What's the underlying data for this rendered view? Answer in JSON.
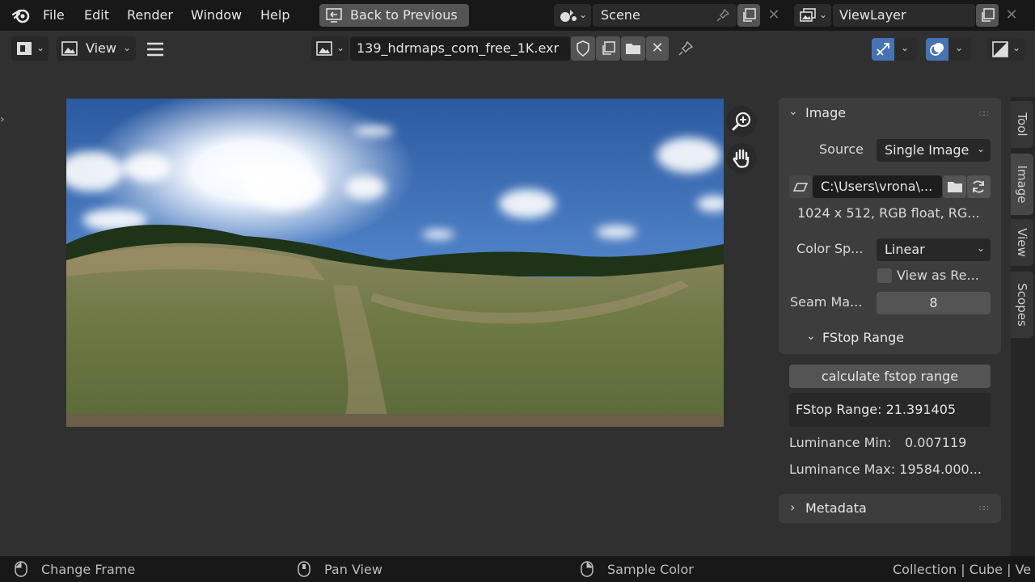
{
  "menu": [
    "File",
    "Edit",
    "Render",
    "Window",
    "Help"
  ],
  "back_button": "Back to Previous",
  "scene_name": "Scene",
  "viewlayer_name": "ViewLayer",
  "header": {
    "view_label": "View",
    "image_name": "139_hdrmaps_com_free_1K.exr"
  },
  "image_panel": {
    "title": "Image",
    "source_label": "Source",
    "source_value": "Single Image",
    "filepath": "C:\\Users\\vrona\\...",
    "info": "1024 x 512,  RGB float,  RG...",
    "color_space_label": "Color Sp...",
    "color_space_value": "Linear",
    "view_as_render_label": "View as Re...",
    "seam_label": "Seam Ma...",
    "seam_value": "8",
    "fstop_title": "FStop Range"
  },
  "fstop": {
    "calc_button": "calculate fstop range",
    "range_text": "FStop Range: 21.391405",
    "lum_min_label": "Luminance Min:",
    "lum_min_value": "0.007119",
    "lum_max_text": "Luminance Max: 19584.000..."
  },
  "metadata_title": "Metadata",
  "sidebar_tabs": [
    "Tool",
    "Image",
    "View",
    "Scopes"
  ],
  "status": {
    "change_frame": "Change Frame",
    "pan_view": "Pan View",
    "sample_color": "Sample Color",
    "right": "Collection | Cube | Ve"
  },
  "colors": {
    "accent": "#4772b3",
    "topbar": "#181818",
    "panel": "#3d3d3d"
  }
}
